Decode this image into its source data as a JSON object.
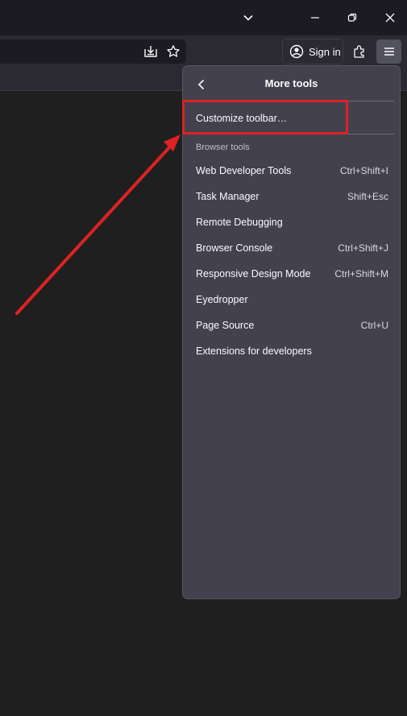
{
  "panel": {
    "title": "More tools",
    "customize_label": "Customize toolbar…",
    "section_label": "Browser tools",
    "items": [
      {
        "label": "Web Developer Tools",
        "shortcut": "Ctrl+Shift+I"
      },
      {
        "label": "Task Manager",
        "shortcut": "Shift+Esc"
      },
      {
        "label": "Remote Debugging",
        "shortcut": ""
      },
      {
        "label": "Browser Console",
        "shortcut": "Ctrl+Shift+J"
      },
      {
        "label": "Responsive Design Mode",
        "shortcut": "Ctrl+Shift+M"
      },
      {
        "label": "Eyedropper",
        "shortcut": ""
      },
      {
        "label": "Page Source",
        "shortcut": "Ctrl+U"
      },
      {
        "label": "Extensions for developers",
        "shortcut": ""
      }
    ]
  },
  "toolbar": {
    "signin_label": "Sign in"
  },
  "icons": {
    "list_all_tabs": "chevron-down-icon",
    "minimize": "minimize-icon",
    "restore": "restore-icon",
    "close": "close-icon",
    "save_to_pocket": "download-icon",
    "bookmark": "star-icon",
    "account": "account-icon",
    "extensions": "puzzle-icon",
    "menu": "hamburger-icon",
    "back": "chevron-left-icon"
  },
  "colors": {
    "highlight": "#dd2222",
    "panel_bg": "#42414d",
    "page_bg": "#1f1f1f"
  }
}
